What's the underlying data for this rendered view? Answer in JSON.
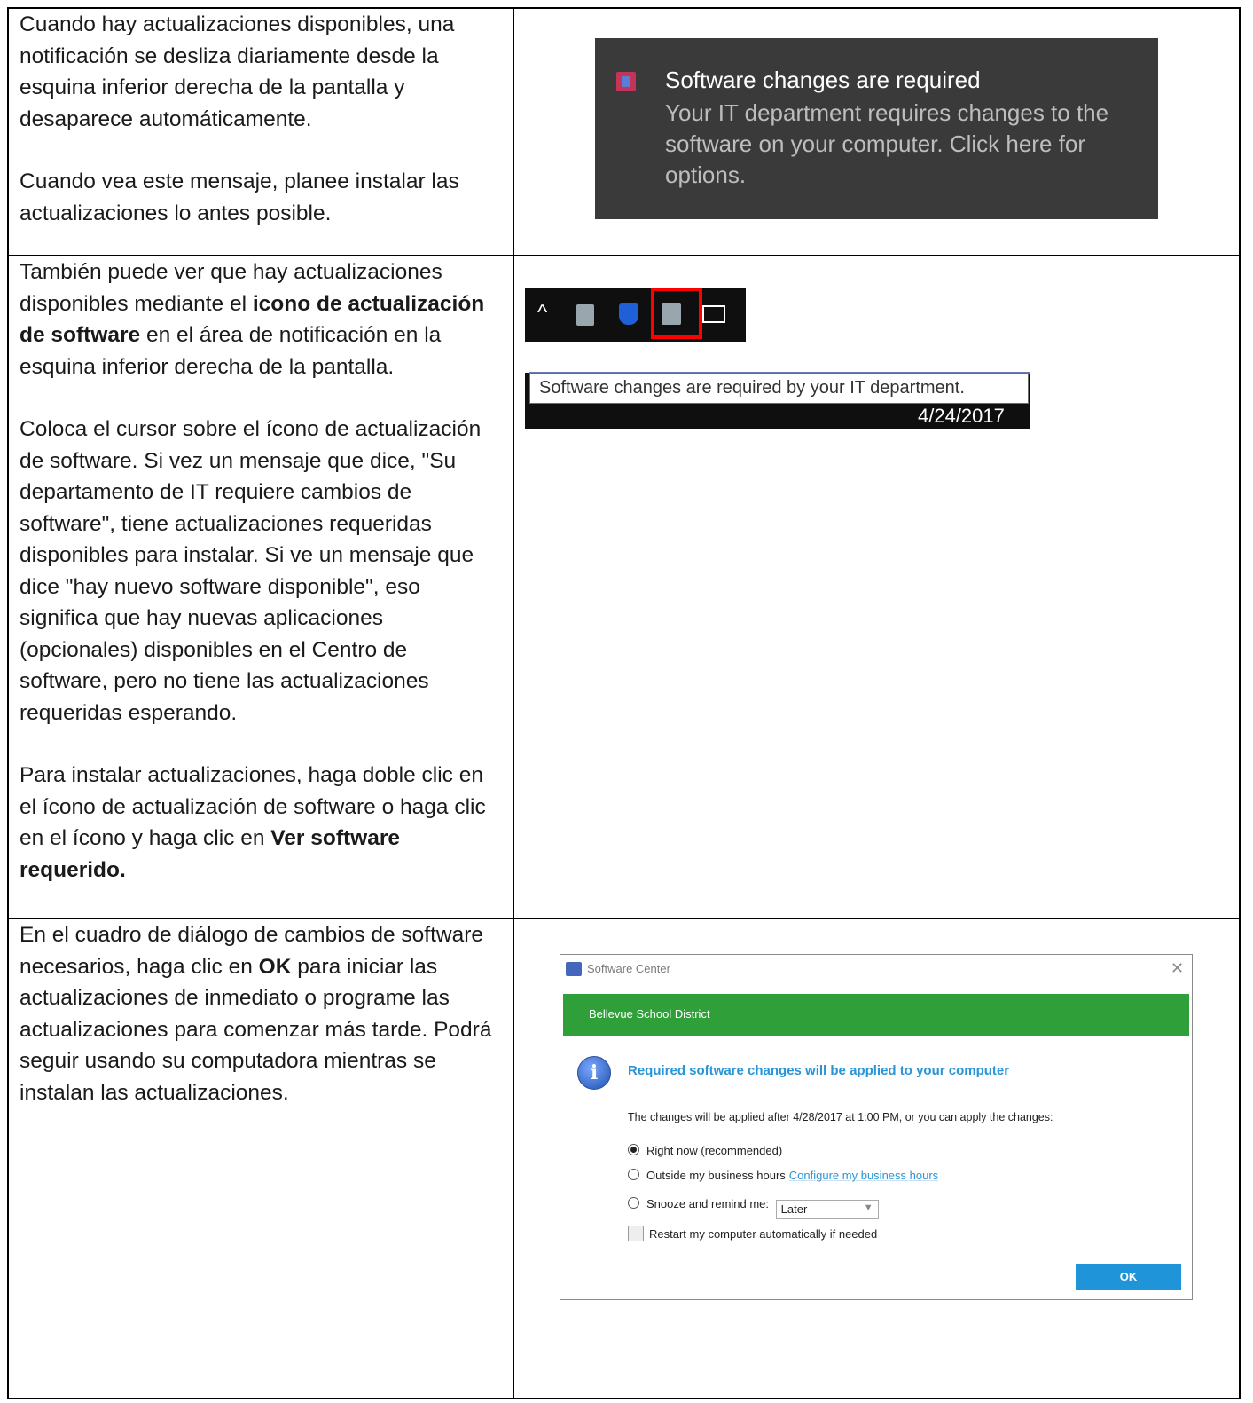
{
  "row1": {
    "para1": " Cuando hay actualizaciones disponibles, una notificación se desliza diariamente desde la esquina inferior derecha de la pantalla y desaparece automáticamente.",
    "para2": " Cuando vea este mensaje, planee instalar las actualizaciones lo antes posible."
  },
  "toast": {
    "title": "Software changes are required",
    "body": "Your IT department requires changes to the software on your computer. Click here for options."
  },
  "row2": {
    "para1_a": "También puede ver que hay actualizaciones disponibles mediante el ",
    "para1_b": "icono de actualización de software",
    "para1_c": " en el área de notificación en la esquina inferior derecha de la pantalla.",
    "para2": "Coloca el cursor sobre el ícono de actualización de software. Si vez un mensaje que dice, \"Su departamento de IT requiere cambios de software\", tiene actualizaciones requeridas disponibles para instalar. Si ve un mensaje que dice \"hay nuevo software disponible\", eso significa que hay nuevas aplicaciones (opcionales) disponibles en el Centro de software, pero no tiene las actualizaciones requeridas esperando.",
    "para3_a": "Para instalar actualizaciones, haga doble clic en el ícono de actualización de software o haga clic en el ícono y haga clic en ",
    "para3_b": "Ver software requerido."
  },
  "tooltip": {
    "text": "Software changes are required by your IT department.",
    "date": "4/24/2017"
  },
  "row3": {
    "para_a": "En el cuadro de diálogo de cambios de software necesarios, haga clic en ",
    "para_b": "OK",
    "para_c": " para iniciar las actualizaciones de inmediato o programe las actualizaciones para comenzar más tarde. Podrá seguir usando su computadora mientras se instalan las actualizaciones."
  },
  "dialog": {
    "window_title": "Software Center",
    "organization": "Bellevue School District",
    "heading": "Required software changes will be applied to your computer",
    "description": "The changes will be applied after 4/28/2017 at 1:00 PM, or you can apply the changes:",
    "option_now": "Right now (recommended)",
    "option_outside": "Outside my business hours",
    "configure_link": "Configure my business hours",
    "option_snooze": "Snooze and remind me:",
    "snooze_value": "Later",
    "restart_label": "Restart my computer automatically if needed",
    "ok_label": "OK"
  }
}
